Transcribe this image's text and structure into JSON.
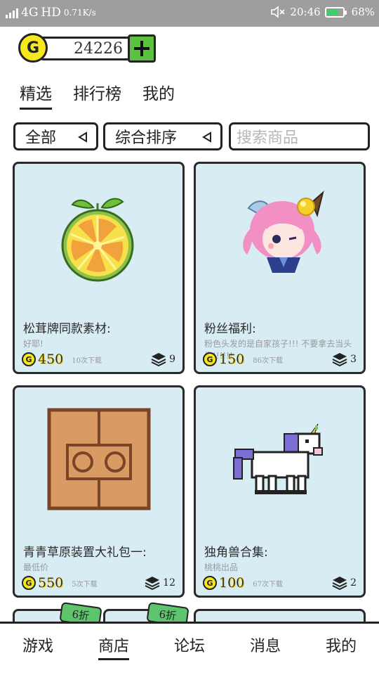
{
  "status_bar": {
    "network": "4G",
    "hd": "HD",
    "speed": "0.71K/s",
    "time": "20:46",
    "battery": "68%",
    "battery_level": 0.68,
    "icons": [
      "signal-icon",
      "mute-icon",
      "battery-icon"
    ]
  },
  "wallet": {
    "coin_symbol": "G",
    "balance": "24226",
    "add_icon": "plus-icon",
    "colors": {
      "coin": "#f6e81c",
      "add": "#5cc13e"
    }
  },
  "tabs": [
    {
      "label": "精选",
      "active": true
    },
    {
      "label": "排行榜",
      "active": false
    },
    {
      "label": "我的",
      "active": false
    }
  ],
  "filters": {
    "category": "全部",
    "sort": "综合排序",
    "search_placeholder": "搜索商品"
  },
  "cards": [
    {
      "title": "松茸牌同款素材:",
      "desc": "好耶!",
      "price": "450",
      "downloads": "10次下载",
      "count": "9",
      "image": "lemon-slice-icon"
    },
    {
      "title": "粉丝福利:",
      "desc": "粉色头发的是自家孩子!!! 不要拿去当头像!!!!!!",
      "price": "150",
      "downloads": "86次下载",
      "count": "3",
      "image": "pink-hair-girl-icon"
    },
    {
      "title": "青青草原装置大礼包一:",
      "desc": "最低价",
      "price": "550",
      "downloads": "5次下载",
      "count": "12",
      "image": "wooden-panel-icon"
    },
    {
      "title": "独角兽合集:",
      "desc": "桃桃出品",
      "price": "100",
      "downloads": "67次下载",
      "count": "2",
      "image": "unicorn-icon"
    }
  ],
  "partial_row": {
    "discount_1": "6折",
    "discount_2": "6折"
  },
  "bottom_nav": [
    {
      "label": "游戏",
      "active": false
    },
    {
      "label": "商店",
      "active": true
    },
    {
      "label": "论坛",
      "active": false
    },
    {
      "label": "消息",
      "active": false
    },
    {
      "label": "我的",
      "active": false
    }
  ],
  "colors": {
    "card_bg": "#d8ecf4",
    "border": "#222222",
    "status_bar": "#9e9e9e",
    "discount": "#5ec46e"
  }
}
